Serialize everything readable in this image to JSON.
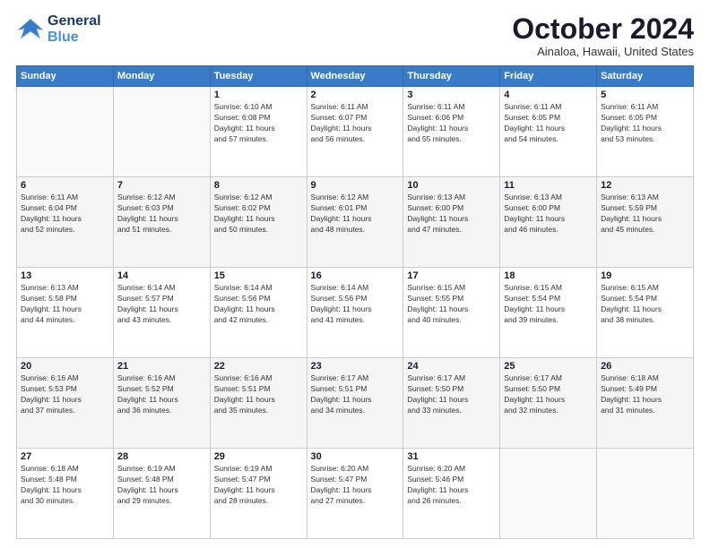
{
  "header": {
    "logo_general": "General",
    "logo_blue": "Blue",
    "month_title": "October 2024",
    "location": "Ainaloa, Hawaii, United States"
  },
  "days_of_week": [
    "Sunday",
    "Monday",
    "Tuesday",
    "Wednesday",
    "Thursday",
    "Friday",
    "Saturday"
  ],
  "weeks": [
    [
      {
        "day": "",
        "info": ""
      },
      {
        "day": "",
        "info": ""
      },
      {
        "day": "1",
        "info": "Sunrise: 6:10 AM\nSunset: 6:08 PM\nDaylight: 11 hours\nand 57 minutes."
      },
      {
        "day": "2",
        "info": "Sunrise: 6:11 AM\nSunset: 6:07 PM\nDaylight: 11 hours\nand 56 minutes."
      },
      {
        "day": "3",
        "info": "Sunrise: 6:11 AM\nSunset: 6:06 PM\nDaylight: 11 hours\nand 55 minutes."
      },
      {
        "day": "4",
        "info": "Sunrise: 6:11 AM\nSunset: 6:05 PM\nDaylight: 11 hours\nand 54 minutes."
      },
      {
        "day": "5",
        "info": "Sunrise: 6:11 AM\nSunset: 6:05 PM\nDaylight: 11 hours\nand 53 minutes."
      }
    ],
    [
      {
        "day": "6",
        "info": "Sunrise: 6:11 AM\nSunset: 6:04 PM\nDaylight: 11 hours\nand 52 minutes."
      },
      {
        "day": "7",
        "info": "Sunrise: 6:12 AM\nSunset: 6:03 PM\nDaylight: 11 hours\nand 51 minutes."
      },
      {
        "day": "8",
        "info": "Sunrise: 6:12 AM\nSunset: 6:02 PM\nDaylight: 11 hours\nand 50 minutes."
      },
      {
        "day": "9",
        "info": "Sunrise: 6:12 AM\nSunset: 6:01 PM\nDaylight: 11 hours\nand 48 minutes."
      },
      {
        "day": "10",
        "info": "Sunrise: 6:13 AM\nSunset: 6:00 PM\nDaylight: 11 hours\nand 47 minutes."
      },
      {
        "day": "11",
        "info": "Sunrise: 6:13 AM\nSunset: 6:00 PM\nDaylight: 11 hours\nand 46 minutes."
      },
      {
        "day": "12",
        "info": "Sunrise: 6:13 AM\nSunset: 5:59 PM\nDaylight: 11 hours\nand 45 minutes."
      }
    ],
    [
      {
        "day": "13",
        "info": "Sunrise: 6:13 AM\nSunset: 5:58 PM\nDaylight: 11 hours\nand 44 minutes."
      },
      {
        "day": "14",
        "info": "Sunrise: 6:14 AM\nSunset: 5:57 PM\nDaylight: 11 hours\nand 43 minutes."
      },
      {
        "day": "15",
        "info": "Sunrise: 6:14 AM\nSunset: 5:56 PM\nDaylight: 11 hours\nand 42 minutes."
      },
      {
        "day": "16",
        "info": "Sunrise: 6:14 AM\nSunset: 5:56 PM\nDaylight: 11 hours\nand 41 minutes."
      },
      {
        "day": "17",
        "info": "Sunrise: 6:15 AM\nSunset: 5:55 PM\nDaylight: 11 hours\nand 40 minutes."
      },
      {
        "day": "18",
        "info": "Sunrise: 6:15 AM\nSunset: 5:54 PM\nDaylight: 11 hours\nand 39 minutes."
      },
      {
        "day": "19",
        "info": "Sunrise: 6:15 AM\nSunset: 5:54 PM\nDaylight: 11 hours\nand 38 minutes."
      }
    ],
    [
      {
        "day": "20",
        "info": "Sunrise: 6:16 AM\nSunset: 5:53 PM\nDaylight: 11 hours\nand 37 minutes."
      },
      {
        "day": "21",
        "info": "Sunrise: 6:16 AM\nSunset: 5:52 PM\nDaylight: 11 hours\nand 36 minutes."
      },
      {
        "day": "22",
        "info": "Sunrise: 6:16 AM\nSunset: 5:51 PM\nDaylight: 11 hours\nand 35 minutes."
      },
      {
        "day": "23",
        "info": "Sunrise: 6:17 AM\nSunset: 5:51 PM\nDaylight: 11 hours\nand 34 minutes."
      },
      {
        "day": "24",
        "info": "Sunrise: 6:17 AM\nSunset: 5:50 PM\nDaylight: 11 hours\nand 33 minutes."
      },
      {
        "day": "25",
        "info": "Sunrise: 6:17 AM\nSunset: 5:50 PM\nDaylight: 11 hours\nand 32 minutes."
      },
      {
        "day": "26",
        "info": "Sunrise: 6:18 AM\nSunset: 5:49 PM\nDaylight: 11 hours\nand 31 minutes."
      }
    ],
    [
      {
        "day": "27",
        "info": "Sunrise: 6:18 AM\nSunset: 5:48 PM\nDaylight: 11 hours\nand 30 minutes."
      },
      {
        "day": "28",
        "info": "Sunrise: 6:19 AM\nSunset: 5:48 PM\nDaylight: 11 hours\nand 29 minutes."
      },
      {
        "day": "29",
        "info": "Sunrise: 6:19 AM\nSunset: 5:47 PM\nDaylight: 11 hours\nand 28 minutes."
      },
      {
        "day": "30",
        "info": "Sunrise: 6:20 AM\nSunset: 5:47 PM\nDaylight: 11 hours\nand 27 minutes."
      },
      {
        "day": "31",
        "info": "Sunrise: 6:20 AM\nSunset: 5:46 PM\nDaylight: 11 hours\nand 26 minutes."
      },
      {
        "day": "",
        "info": ""
      },
      {
        "day": "",
        "info": ""
      }
    ]
  ]
}
